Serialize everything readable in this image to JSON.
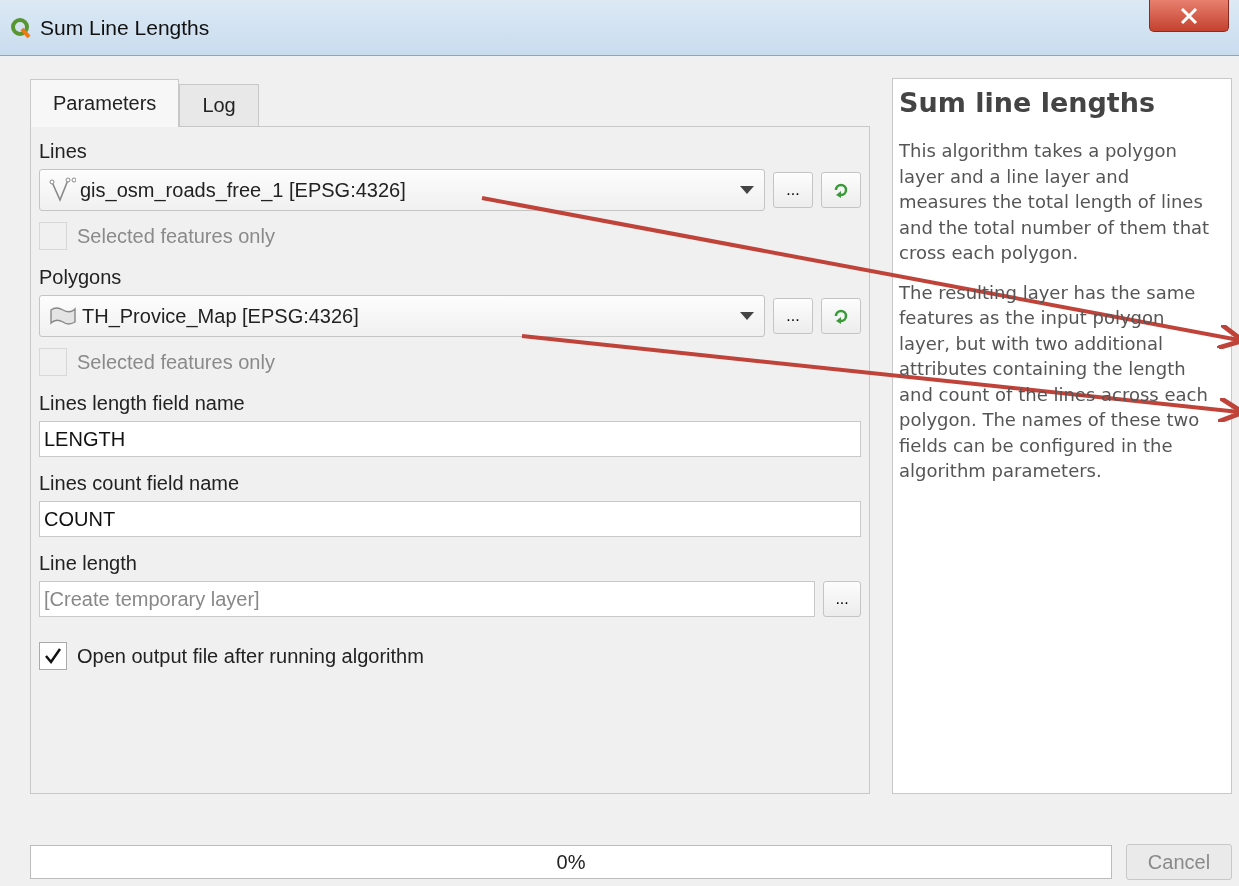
{
  "window": {
    "title": "Sum Line Lengths"
  },
  "tabs": [
    {
      "label": "Parameters",
      "selected": true
    },
    {
      "label": "Log",
      "selected": false
    }
  ],
  "parameters": [
    {
      "kind": "layer",
      "label": "Lines",
      "value": "gis_osm_roads_free_1 [EPSG:4326]",
      "layer_icon": {
        "kind": "line"
      },
      "browse_label": "...",
      "selected_only": {
        "label": "Selected features only",
        "checked": false,
        "disabled": true
      }
    },
    {
      "kind": "layer",
      "label": "Polygons",
      "value": "TH_Provice_Map [EPSG:4326]",
      "layer_icon": {
        "kind": "polygon"
      },
      "browse_label": "...",
      "selected_only": {
        "label": "Selected features only",
        "checked": false,
        "disabled": true
      }
    },
    {
      "kind": "text",
      "label": "Lines length field name",
      "value": "LENGTH"
    },
    {
      "kind": "text",
      "label": "Lines count field name",
      "value": "COUNT"
    },
    {
      "kind": "output",
      "label": "Line length",
      "placeholder": "[Create temporary layer]",
      "browse_label": "..."
    },
    {
      "kind": "checkbox",
      "label": "Open output file after running algorithm",
      "checked": true
    }
  ],
  "help": {
    "title": "Sum line lengths",
    "paragraphs": [
      "This algorithm takes a polygon layer and a line layer and measures the total length of lines and the total number of them that cross each polygon.",
      "The resulting layer has the same features as the input polygon layer, but with two additional attributes containing the length and count of the lines across each polygon. The names of these two fields can be configured in the algorithm parameters."
    ]
  },
  "progress": {
    "level": 0,
    "text": "0%"
  },
  "cancel_button": {
    "label": "Cancel",
    "disabled": true
  }
}
